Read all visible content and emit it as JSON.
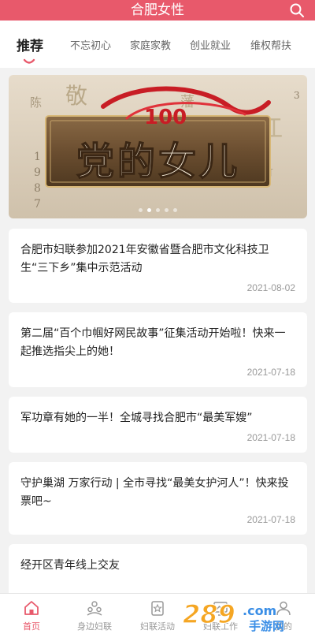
{
  "header": {
    "title": "合肥女性"
  },
  "tabs": [
    {
      "label": "推荐",
      "active": true
    },
    {
      "label": "不忘初心"
    },
    {
      "label": "家庭家教"
    },
    {
      "label": "创业就业"
    },
    {
      "label": "维权帮扶"
    }
  ],
  "banner": {
    "title": "党的女儿",
    "number": "100",
    "background_text": [
      "敬",
      "藩",
      "陈",
      "江",
      "竹",
      "1",
      "9",
      "8",
      "7",
      "3"
    ],
    "slides": 5,
    "active_slide": 1
  },
  "articles": [
    {
      "title": "合肥市妇联参加2021年安徽省暨合肥市文化科技卫生“三下乡”集中示范活动",
      "date": "2021-08-02"
    },
    {
      "title": "第二届“百个巾帼好网民故事”征集活动开始啦！快来一起推选指尖上的她！",
      "date": "2021-07-18"
    },
    {
      "title": "军功章有她的一半！全城寻找合肥市“最美军嫂”",
      "date": "2021-07-18"
    },
    {
      "title": "守护巢湖 万家行动 | 全市寻找“最美女护河人”！快来投票吧~",
      "date": "2021-07-18"
    },
    {
      "title": "经开区青年线上交友",
      "date": ""
    }
  ],
  "tabbar": [
    {
      "label": "首页",
      "icon": "home-icon",
      "active": true
    },
    {
      "label": "身边妇联",
      "icon": "people-icon"
    },
    {
      "label": "妇联活动",
      "icon": "activity-icon"
    },
    {
      "label": "妇联工作",
      "icon": "work-icon"
    },
    {
      "label": "我的",
      "icon": "user-icon"
    }
  ],
  "watermark": {
    "brand": "289",
    "suffix": ".com",
    "sub": "手游网"
  },
  "colors": {
    "accent": "#e8596b",
    "text": "#222222",
    "muted": "#999999",
    "background": "#f2f2f2"
  }
}
